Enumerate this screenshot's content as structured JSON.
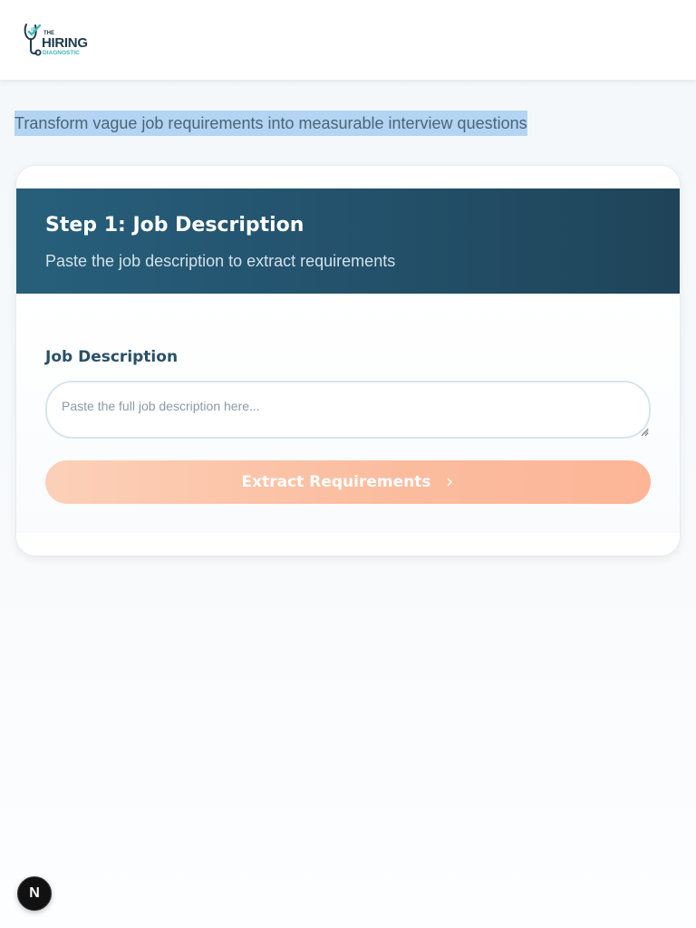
{
  "header": {
    "logo": {
      "line1": "THE",
      "line2": "HIRING",
      "line3": "DIAGNOSTIC",
      "icon": "stethoscope-check-icon"
    }
  },
  "tagline": "Transform vague job requirements into measurable interview questions",
  "step": {
    "title": "Step 1: Job Description",
    "subtitle": "Paste the job description to extract requirements"
  },
  "form": {
    "label": "Job Description",
    "placeholder": "Paste the full job description here...",
    "value": "",
    "submit_label": "Extract Requirements",
    "submit_icon": "chevron-right-icon"
  },
  "badge": {
    "letter": "N",
    "icon": "next-dev-indicator-icon"
  },
  "colors": {
    "header_start": "#275f7b",
    "header_end": "#1f4459",
    "button_start": "#fcd0b8",
    "button_end": "#fcb597",
    "selection": "#b3d4f3",
    "brand_teal": "#3fb6b9",
    "brand_navy": "#1f3b4d"
  }
}
